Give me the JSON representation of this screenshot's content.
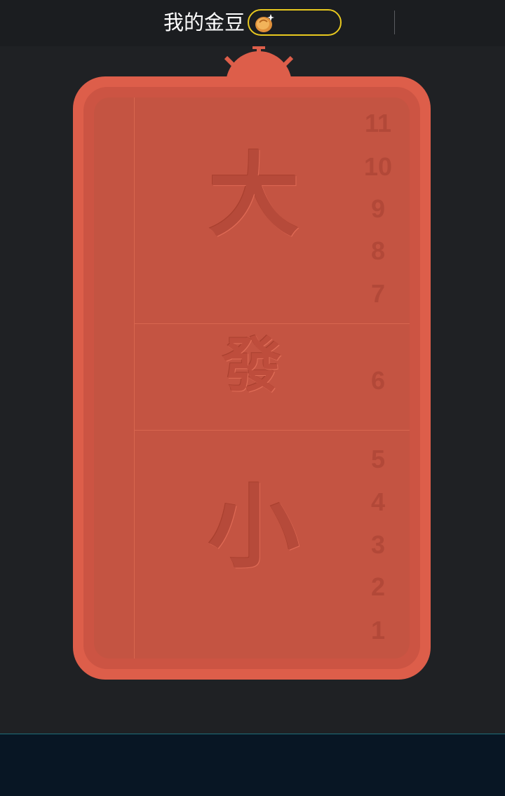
{
  "header": {
    "title": "我的金豆",
    "bean_icon": "gold-bean-icon",
    "bean_value": "",
    "pill_color": "#e8c81f"
  },
  "board": {
    "colors": {
      "outer": "#dd5e4a",
      "panel": "#c45442",
      "text": "#b64a3a"
    },
    "sections": [
      {
        "label": "大",
        "numbers": [
          "11",
          "10",
          "9",
          "8",
          "7"
        ]
      },
      {
        "label": "發",
        "numbers": [
          "6"
        ]
      },
      {
        "label": "小",
        "numbers": [
          "5",
          "4",
          "3",
          "2",
          "1"
        ]
      }
    ]
  }
}
